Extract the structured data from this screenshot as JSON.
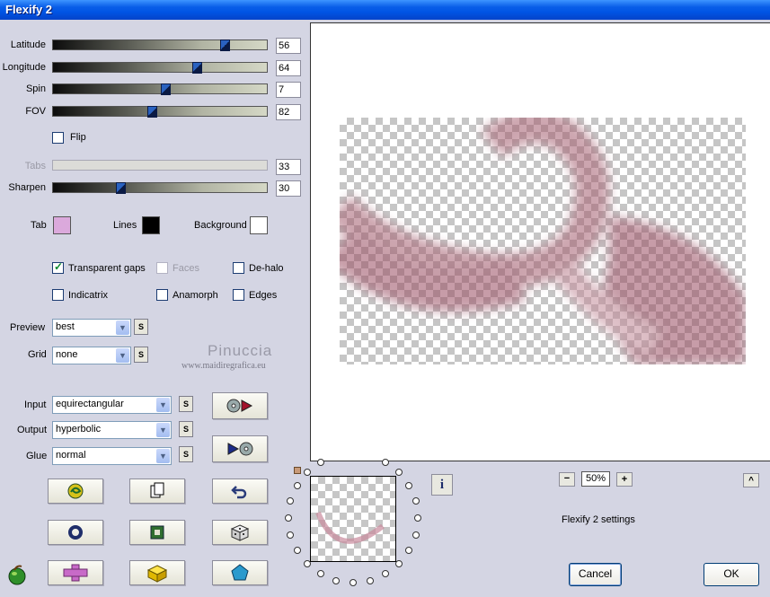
{
  "window": {
    "title": "Flexify 2"
  },
  "sliders": [
    {
      "label": "Latitude",
      "value": "56",
      "fraction": 0.8
    },
    {
      "label": "Longitude",
      "value": "64",
      "fraction": 0.67
    },
    {
      "label": "Spin",
      "value": "7",
      "fraction": 0.52
    },
    {
      "label": "FOV",
      "value": "82",
      "fraction": 0.46
    },
    {
      "label": "Tabs",
      "value": "33",
      "disabled": true
    },
    {
      "label": "Sharpen",
      "value": "30",
      "fraction": 0.31
    }
  ],
  "flip": {
    "label": "Flip",
    "checked": false
  },
  "colors": {
    "tab": {
      "label": "Tab",
      "color": "#dba9dc"
    },
    "lines": {
      "label": "Lines",
      "color": "#000000"
    },
    "background": {
      "label": "Background",
      "color": "#ffffff"
    }
  },
  "options": {
    "transparent_gaps": {
      "label": "Transparent gaps",
      "checked": true
    },
    "faces": {
      "label": "Faces",
      "checked": false,
      "disabled": true
    },
    "de_halo": {
      "label": "De-halo",
      "checked": false
    },
    "indicatrix": {
      "label": "Indicatrix",
      "checked": false
    },
    "anamorph": {
      "label": "Anamorph",
      "checked": false
    },
    "edges": {
      "label": "Edges",
      "checked": false
    }
  },
  "preview_select": {
    "label": "Preview",
    "value": "best"
  },
  "grid_select": {
    "label": "Grid",
    "value": "none"
  },
  "watermark": {
    "name": "Pinuccia",
    "site": "www.maidiregrafica.eu"
  },
  "input_select": {
    "label": "Input",
    "value": "equirectangular"
  },
  "output_select": {
    "label": "Output",
    "value": "hyperbolic"
  },
  "glue_select": {
    "label": "Glue",
    "value": "normal"
  },
  "s_button": "S",
  "zoom": {
    "value": "50%",
    "minus": "−",
    "plus": "+"
  },
  "up_button": "^",
  "info_button": "i",
  "settings_text": "Flexify 2 settings",
  "buttons": {
    "cancel": "Cancel",
    "ok": "OK"
  }
}
